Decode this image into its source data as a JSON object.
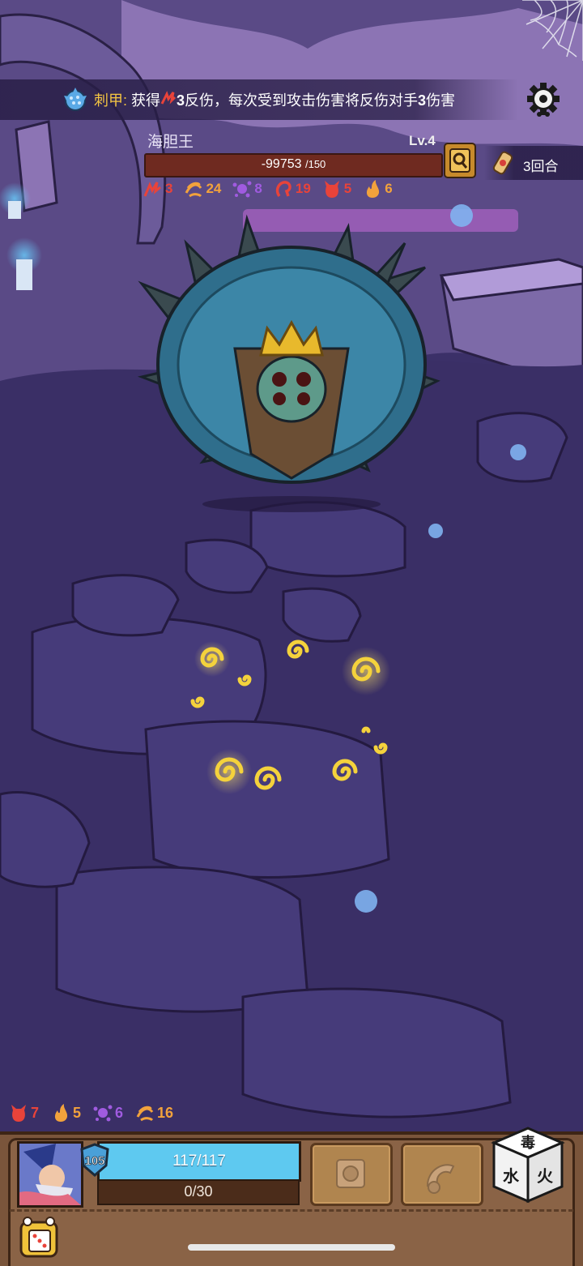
{
  "tip": {
    "keyword": "刺甲:",
    "text_a": "获得",
    "value": "3",
    "text_b": "反伤，每次受到攻击伤害将反伤对手",
    "value2": "3",
    "text_c": "伤害",
    "icon": "spiked-armor-icon"
  },
  "settings": {
    "icon": "gear-icon"
  },
  "boss": {
    "name": "海胆王",
    "level": "Lv.4",
    "hp_current": "-99753",
    "hp_max": "/150",
    "hp_fraction": 0,
    "stats": [
      {
        "icon": "claw-icon",
        "value": "3",
        "color": "#e8433a"
      },
      {
        "icon": "wind-icon",
        "value": "24",
        "color": "#f2a23c"
      },
      {
        "icon": "splat-icon",
        "value": "8",
        "color": "#a05be0"
      },
      {
        "icon": "hook-icon",
        "value": "19",
        "color": "#e8433a"
      },
      {
        "icon": "devil-icon",
        "value": "5",
        "color": "#e8433a"
      },
      {
        "icon": "flame-icon",
        "value": "6",
        "color": "#f2a23c"
      }
    ]
  },
  "rounds": {
    "label": "3回合",
    "icon": "scroll-icon"
  },
  "player": {
    "stats": [
      {
        "icon": "devil-icon",
        "value": "7",
        "color": "#e8433a"
      },
      {
        "icon": "flame-icon",
        "value": "5",
        "color": "#f2a23c"
      },
      {
        "icon": "splat-icon",
        "value": "6",
        "color": "#a05be0"
      },
      {
        "icon": "wind-icon",
        "value": "16",
        "color": "#f2a23c"
      }
    ],
    "level": "105",
    "hp": "117/117",
    "hp_fraction": 1.0,
    "xp": "0/30",
    "xp_fraction": 0
  },
  "skills": [
    {
      "icon": "gear-block-icon"
    },
    {
      "icon": "hook-arm-icon"
    }
  ],
  "dice": {
    "icon": "dice-icon",
    "faces": [
      "毒",
      "水",
      "火"
    ]
  },
  "bag": {
    "icon": "dice-bag-icon"
  },
  "colors": {
    "hp_blue": "#5ec9f0",
    "boss_hp": "#6f2a20",
    "keyword": "#f4c542",
    "panel": "#8a6346"
  }
}
